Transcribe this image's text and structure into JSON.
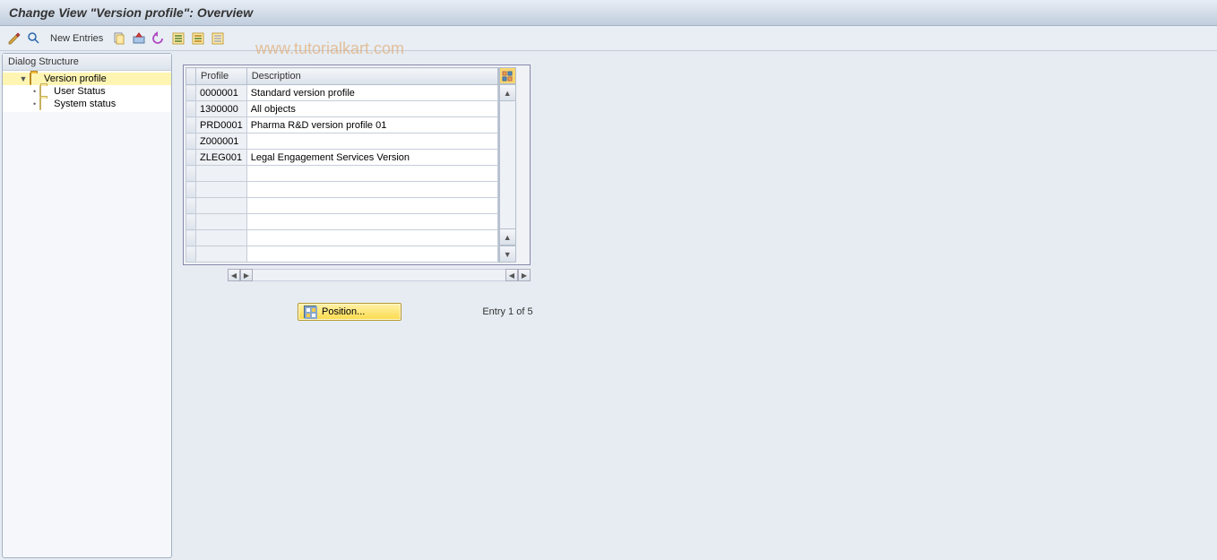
{
  "title": "Change View \"Version profile\": Overview",
  "watermark": "www.tutorialkart.com",
  "toolbar": {
    "new_entries": "New Entries"
  },
  "tree": {
    "header": "Dialog Structure",
    "items": [
      {
        "label": "Version profile",
        "selected": true,
        "level": 1,
        "open": true,
        "expandable": true
      },
      {
        "label": "User Status",
        "selected": false,
        "level": 2,
        "open": false,
        "expandable": false
      },
      {
        "label": "System status",
        "selected": false,
        "level": 2,
        "open": false,
        "expandable": false
      }
    ]
  },
  "grid": {
    "columns": {
      "profile": "Profile",
      "description": "Description"
    },
    "rows": [
      {
        "profile": "0000001",
        "description": "Standard version profile"
      },
      {
        "profile": "1300000",
        "description": "All objects"
      },
      {
        "profile": "PRD0001",
        "description": "Pharma R&D version profile 01"
      },
      {
        "profile": "Z000001",
        "description": ""
      },
      {
        "profile": "ZLEG001",
        "description": "Legal Engagement Services Version"
      },
      {
        "profile": "",
        "description": ""
      },
      {
        "profile": "",
        "description": ""
      },
      {
        "profile": "",
        "description": ""
      },
      {
        "profile": "",
        "description": ""
      },
      {
        "profile": "",
        "description": ""
      },
      {
        "profile": "",
        "description": ""
      }
    ]
  },
  "footer": {
    "position_label": "Position...",
    "entry_text": "Entry 1 of 5"
  }
}
